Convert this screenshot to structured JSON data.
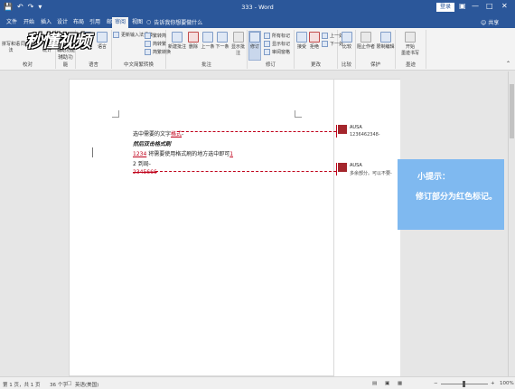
{
  "titlebar": {
    "document_title": "333 - Word",
    "login": "登录",
    "quick_access": [
      "save-icon",
      "undo-icon",
      "redo-icon",
      "customize-icon"
    ],
    "window_controls": [
      "ribbon-display-icon",
      "minimize-icon",
      "maximize-icon",
      "close-icon"
    ]
  },
  "tabs": [
    {
      "label": "文件"
    },
    {
      "label": "开始"
    },
    {
      "label": "插入"
    },
    {
      "label": "设计"
    },
    {
      "label": "布局"
    },
    {
      "label": "引用"
    },
    {
      "label": "邮件"
    },
    {
      "label": "审阅",
      "active": true
    },
    {
      "label": "视图"
    }
  ],
  "tellme": "告诉我你想要做什么",
  "share": "共享",
  "logo_text": "秒懂视频",
  "ribbon": {
    "proofing": {
      "label": "校对",
      "spelling": "拼写和语法",
      "thesaurus": "同义词库",
      "wordcount_a": "字数",
      "wordcount_b": "统计"
    },
    "accessibility": {
      "label": "辅助功能",
      "btn_a": "检查",
      "btn_b": "辅助功能"
    },
    "language": {
      "label": "语言",
      "translate": "翻译",
      "language": "语言"
    },
    "chinese": {
      "label": "中文简繁转换",
      "t2s": "繁转简",
      "s2t": "简转繁",
      "convert": "简繁转换"
    },
    "ime": {
      "label": "更新输入法词典"
    },
    "comments": {
      "label": "批注",
      "new": "新建批注",
      "delete": "删除",
      "prev": "上一条",
      "next": "下一条",
      "show": "显示批注"
    },
    "tracking": {
      "label": "修订",
      "track": "修订",
      "markup_all": "所有标记",
      "show_markup": "显示标记",
      "review_pane": "审阅窗格"
    },
    "changes": {
      "label": "更改",
      "accept": "接受",
      "reject": "拒绝",
      "prev": "上一处",
      "next": "下一处"
    },
    "compare": {
      "label": "比较",
      "compare": "比较"
    },
    "protect": {
      "label": "保护",
      "block": "阻止作者",
      "restrict": "限制编辑"
    },
    "ink": {
      "label": "墨迹",
      "start_a": "开始",
      "start_b": "墨迹书写"
    }
  },
  "document": {
    "line1_a": "选中需要的文字",
    "line1_b": "格式",
    "line1_c": "-",
    "line2": "然后双击格式刷",
    "line3_a": "1234",
    "line3_b": " 将需要使用格式刷的地方选中即可",
    "line3_c": "1",
    "line4": "2 到局-",
    "line5": "2345666"
  },
  "comments": [
    {
      "author": "AUSA",
      "text": "1236462348-"
    },
    {
      "author": "AUSA",
      "text": "多余部分。可以不要-"
    }
  ],
  "tip": {
    "title": "小提示：",
    "text": "修订部分为红色标记。"
  },
  "status": {
    "pages": "第 1 页，共 1 页",
    "words": "36 个字",
    "lang": "英语(美国)",
    "zoom": "100%"
  }
}
